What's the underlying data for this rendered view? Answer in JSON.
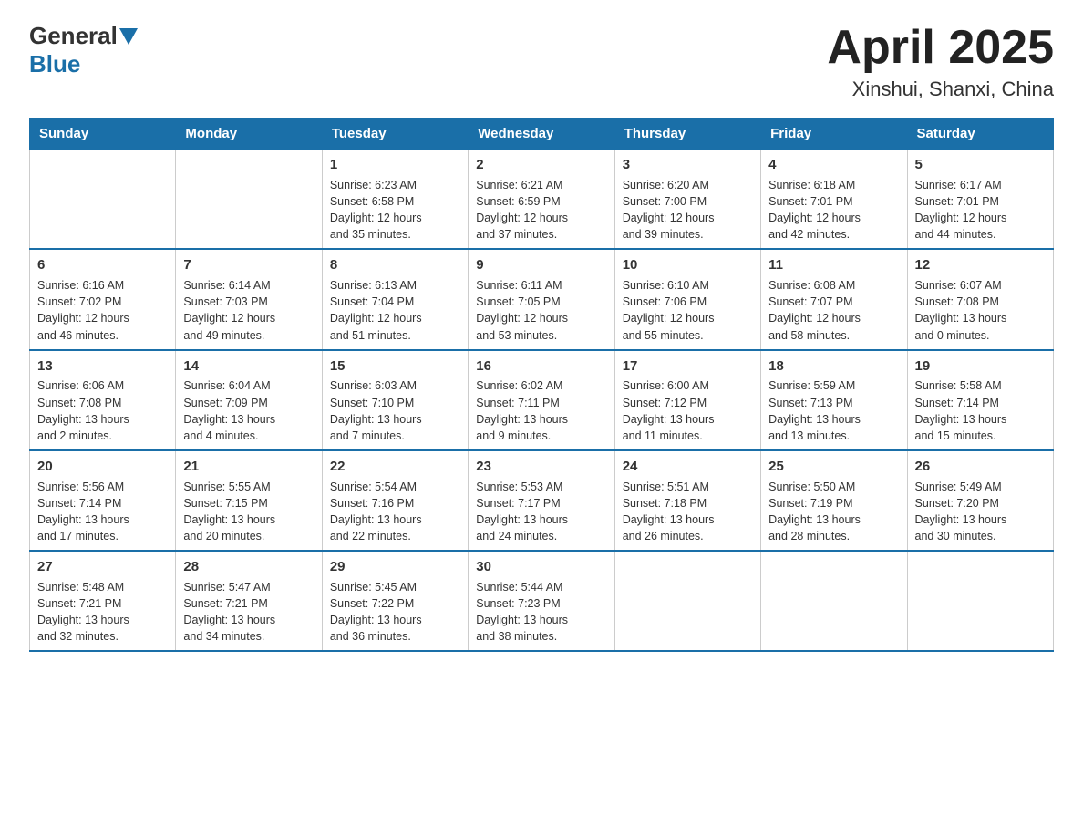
{
  "header": {
    "logo_general": "General",
    "logo_blue": "Blue",
    "title": "April 2025",
    "subtitle": "Xinshui, Shanxi, China"
  },
  "calendar": {
    "days_of_week": [
      "Sunday",
      "Monday",
      "Tuesday",
      "Wednesday",
      "Thursday",
      "Friday",
      "Saturday"
    ],
    "weeks": [
      [
        {
          "day": "",
          "info": ""
        },
        {
          "day": "",
          "info": ""
        },
        {
          "day": "1",
          "info": "Sunrise: 6:23 AM\nSunset: 6:58 PM\nDaylight: 12 hours\nand 35 minutes."
        },
        {
          "day": "2",
          "info": "Sunrise: 6:21 AM\nSunset: 6:59 PM\nDaylight: 12 hours\nand 37 minutes."
        },
        {
          "day": "3",
          "info": "Sunrise: 6:20 AM\nSunset: 7:00 PM\nDaylight: 12 hours\nand 39 minutes."
        },
        {
          "day": "4",
          "info": "Sunrise: 6:18 AM\nSunset: 7:01 PM\nDaylight: 12 hours\nand 42 minutes."
        },
        {
          "day": "5",
          "info": "Sunrise: 6:17 AM\nSunset: 7:01 PM\nDaylight: 12 hours\nand 44 minutes."
        }
      ],
      [
        {
          "day": "6",
          "info": "Sunrise: 6:16 AM\nSunset: 7:02 PM\nDaylight: 12 hours\nand 46 minutes."
        },
        {
          "day": "7",
          "info": "Sunrise: 6:14 AM\nSunset: 7:03 PM\nDaylight: 12 hours\nand 49 minutes."
        },
        {
          "day": "8",
          "info": "Sunrise: 6:13 AM\nSunset: 7:04 PM\nDaylight: 12 hours\nand 51 minutes."
        },
        {
          "day": "9",
          "info": "Sunrise: 6:11 AM\nSunset: 7:05 PM\nDaylight: 12 hours\nand 53 minutes."
        },
        {
          "day": "10",
          "info": "Sunrise: 6:10 AM\nSunset: 7:06 PM\nDaylight: 12 hours\nand 55 minutes."
        },
        {
          "day": "11",
          "info": "Sunrise: 6:08 AM\nSunset: 7:07 PM\nDaylight: 12 hours\nand 58 minutes."
        },
        {
          "day": "12",
          "info": "Sunrise: 6:07 AM\nSunset: 7:08 PM\nDaylight: 13 hours\nand 0 minutes."
        }
      ],
      [
        {
          "day": "13",
          "info": "Sunrise: 6:06 AM\nSunset: 7:08 PM\nDaylight: 13 hours\nand 2 minutes."
        },
        {
          "day": "14",
          "info": "Sunrise: 6:04 AM\nSunset: 7:09 PM\nDaylight: 13 hours\nand 4 minutes."
        },
        {
          "day": "15",
          "info": "Sunrise: 6:03 AM\nSunset: 7:10 PM\nDaylight: 13 hours\nand 7 minutes."
        },
        {
          "day": "16",
          "info": "Sunrise: 6:02 AM\nSunset: 7:11 PM\nDaylight: 13 hours\nand 9 minutes."
        },
        {
          "day": "17",
          "info": "Sunrise: 6:00 AM\nSunset: 7:12 PM\nDaylight: 13 hours\nand 11 minutes."
        },
        {
          "day": "18",
          "info": "Sunrise: 5:59 AM\nSunset: 7:13 PM\nDaylight: 13 hours\nand 13 minutes."
        },
        {
          "day": "19",
          "info": "Sunrise: 5:58 AM\nSunset: 7:14 PM\nDaylight: 13 hours\nand 15 minutes."
        }
      ],
      [
        {
          "day": "20",
          "info": "Sunrise: 5:56 AM\nSunset: 7:14 PM\nDaylight: 13 hours\nand 17 minutes."
        },
        {
          "day": "21",
          "info": "Sunrise: 5:55 AM\nSunset: 7:15 PM\nDaylight: 13 hours\nand 20 minutes."
        },
        {
          "day": "22",
          "info": "Sunrise: 5:54 AM\nSunset: 7:16 PM\nDaylight: 13 hours\nand 22 minutes."
        },
        {
          "day": "23",
          "info": "Sunrise: 5:53 AM\nSunset: 7:17 PM\nDaylight: 13 hours\nand 24 minutes."
        },
        {
          "day": "24",
          "info": "Sunrise: 5:51 AM\nSunset: 7:18 PM\nDaylight: 13 hours\nand 26 minutes."
        },
        {
          "day": "25",
          "info": "Sunrise: 5:50 AM\nSunset: 7:19 PM\nDaylight: 13 hours\nand 28 minutes."
        },
        {
          "day": "26",
          "info": "Sunrise: 5:49 AM\nSunset: 7:20 PM\nDaylight: 13 hours\nand 30 minutes."
        }
      ],
      [
        {
          "day": "27",
          "info": "Sunrise: 5:48 AM\nSunset: 7:21 PM\nDaylight: 13 hours\nand 32 minutes."
        },
        {
          "day": "28",
          "info": "Sunrise: 5:47 AM\nSunset: 7:21 PM\nDaylight: 13 hours\nand 34 minutes."
        },
        {
          "day": "29",
          "info": "Sunrise: 5:45 AM\nSunset: 7:22 PM\nDaylight: 13 hours\nand 36 minutes."
        },
        {
          "day": "30",
          "info": "Sunrise: 5:44 AM\nSunset: 7:23 PM\nDaylight: 13 hours\nand 38 minutes."
        },
        {
          "day": "",
          "info": ""
        },
        {
          "day": "",
          "info": ""
        },
        {
          "day": "",
          "info": ""
        }
      ]
    ]
  }
}
